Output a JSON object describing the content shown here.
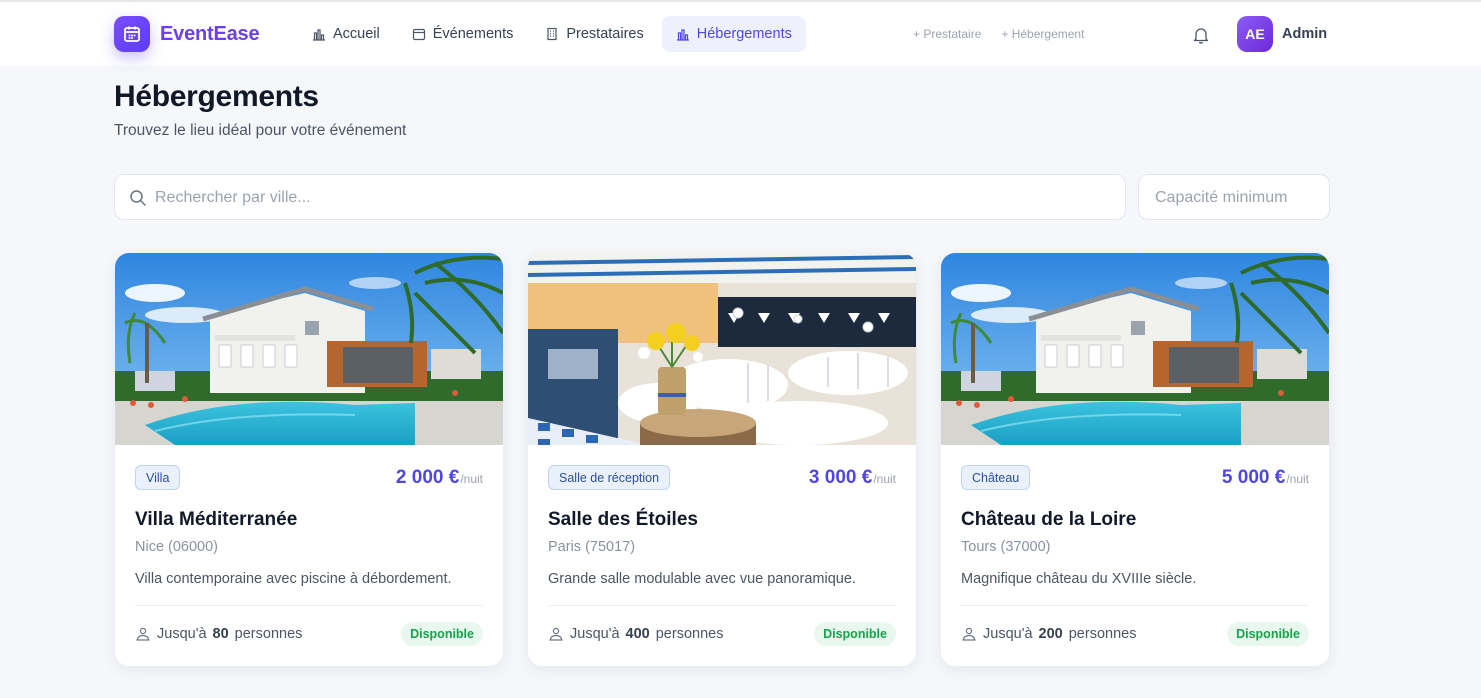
{
  "app": {
    "name": "EventEase",
    "brand_color": "#6d3fe8",
    "accent": "#4f46e5"
  },
  "nav": {
    "items": [
      {
        "label": "Accueil",
        "icon": "chart-icon",
        "active": false
      },
      {
        "label": "Événements",
        "icon": "calendar-icon",
        "active": false
      },
      {
        "label": "Prestataires",
        "icon": "building-icon",
        "active": false
      },
      {
        "label": "Hébergements",
        "icon": "chart-icon",
        "active": true
      }
    ],
    "quick_links": [
      "+ Prestataire",
      "+ Hébergement"
    ]
  },
  "user": {
    "initials": "AE",
    "name": "Admin"
  },
  "page": {
    "title": "Hébergements",
    "subtitle": "Trouvez le lieu idéal pour votre événement"
  },
  "filters": {
    "search_placeholder": "Rechercher par ville...",
    "capacity_placeholder": "Capacité minimum"
  },
  "cards": [
    {
      "type": "Villa",
      "price": "2 000 €",
      "price_unit": "/nuit",
      "title": "Villa Méditerranée",
      "city": "Nice (06000)",
      "description": "Villa contemporaine avec piscine à débordement.",
      "capacity_prefix": "Jusqu'à",
      "capacity": "80",
      "capacity_suffix": "personnes",
      "status": "Disponible",
      "image": "villa-pool-photo"
    },
    {
      "type": "Salle de réception",
      "price": "3 000 €",
      "price_unit": "/nuit",
      "title": "Salle des Étoiles",
      "city": "Paris (75017)",
      "description": "Grande salle modulable avec vue panoramique.",
      "capacity_prefix": "Jusqu'à",
      "capacity": "400",
      "capacity_suffix": "personnes",
      "status": "Disponible",
      "image": "reception-hall-photo"
    },
    {
      "type": "Château",
      "price": "5 000 €",
      "price_unit": "/nuit",
      "title": "Château de la Loire",
      "city": "Tours (37000)",
      "description": "Magnifique château du XVIIIe siècle.",
      "capacity_prefix": "Jusqu'à",
      "capacity": "200",
      "capacity_suffix": "personnes",
      "status": "Disponible",
      "image": "villa-pool-photo"
    }
  ]
}
